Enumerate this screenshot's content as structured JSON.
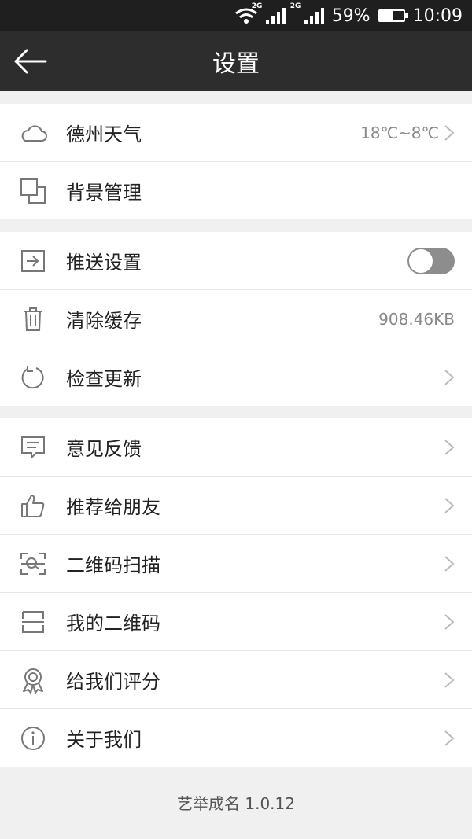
{
  "status_bar": {
    "signal1_net": "2G",
    "signal2_net": "2G",
    "battery_percent": "59%",
    "battery_level": 0.59,
    "time": "10:09"
  },
  "header": {
    "title": "设置"
  },
  "sections": [
    {
      "items": [
        {
          "label": "德州天气",
          "value": "18℃~8℃",
          "icon": "cloud-icon",
          "chevron": true
        },
        {
          "label": "背景管理",
          "icon": "layers-icon",
          "chevron": false
        }
      ]
    },
    {
      "items": [
        {
          "label": "推送设置",
          "icon": "push-icon",
          "toggle": false
        },
        {
          "label": "清除缓存",
          "value": "908.46KB",
          "icon": "trash-icon",
          "chevron": false
        },
        {
          "label": "检查更新",
          "icon": "refresh-icon",
          "chevron": true
        }
      ]
    },
    {
      "items": [
        {
          "label": "意见反馈",
          "icon": "feedback-icon",
          "chevron": true
        },
        {
          "label": "推荐给朋友",
          "icon": "thumbs-up-icon",
          "chevron": true
        },
        {
          "label": "二维码扫描",
          "icon": "scan-icon",
          "chevron": true
        },
        {
          "label": "我的二维码",
          "icon": "qrcode-icon",
          "chevron": true
        },
        {
          "label": "给我们评分",
          "icon": "award-icon",
          "chevron": true
        },
        {
          "label": "关于我们",
          "icon": "info-icon",
          "chevron": true
        }
      ]
    }
  ],
  "footer": {
    "version_text": "艺举成名 1.0.12"
  }
}
